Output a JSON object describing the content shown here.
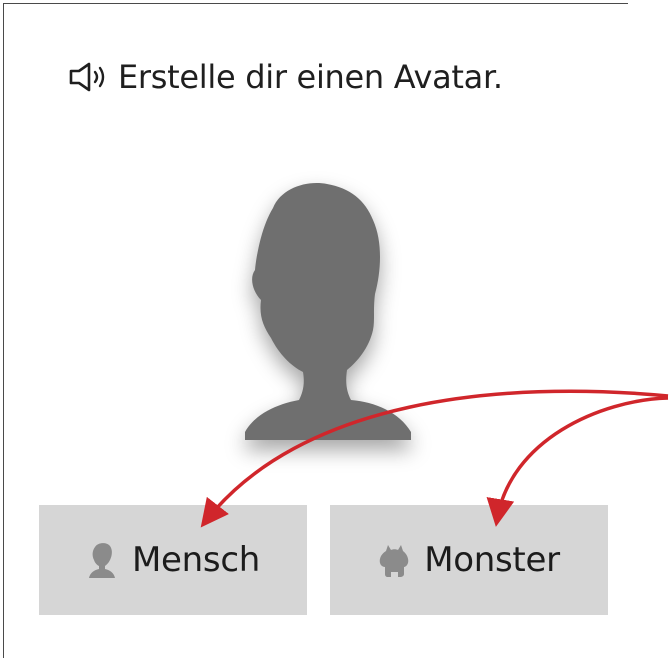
{
  "header": {
    "title": "Erstelle dir einen Avatar.",
    "speaker_icon": "speaker-icon"
  },
  "avatar": {
    "icon": "human-silhouette-icon",
    "color": "#6f6f6f"
  },
  "choices": [
    {
      "label": "Mensch",
      "icon": "human-icon"
    },
    {
      "label": "Monster",
      "icon": "monster-icon"
    }
  ],
  "annotation": {
    "arrow_color": "#d0262b"
  }
}
